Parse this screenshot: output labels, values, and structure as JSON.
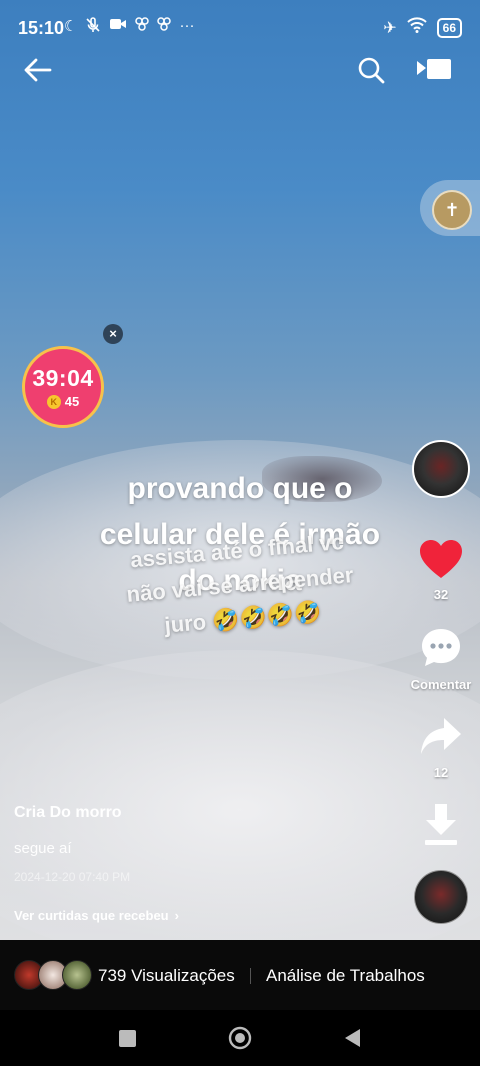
{
  "status": {
    "time": "15:10",
    "left_icons": [
      "moon-icon",
      "mic-off-icon",
      "video-icon",
      "app-icon",
      "app-icon",
      "more-dots-icon"
    ],
    "battery": "66"
  },
  "timer": {
    "time": "39:04",
    "coin_symbol": "K",
    "coins": "45"
  },
  "caption": {
    "line1": "provando que o",
    "line2": "celular dele é irmão",
    "line3": "do nokia",
    "overlay_line1": "assista até o final vc",
    "overlay_line2": "não vai se arrepender",
    "overlay_line3": "juro 🤣🤣🤣🤣"
  },
  "actions": {
    "likes": "32",
    "comment_label": "Comentar",
    "shares": "12"
  },
  "post": {
    "author": "Cria Do morro",
    "description": "segue aí",
    "date": "2024-12-20 07:40 PM",
    "likes_link": "Ver curtidas que recebeu"
  },
  "footer": {
    "views": "739 Visualizações",
    "analysis": "Análise de Trabalhos"
  },
  "colors": {
    "like_red": "#f0233a",
    "timer_pink": "#ef3f6f",
    "timer_border": "#f7c24a"
  }
}
